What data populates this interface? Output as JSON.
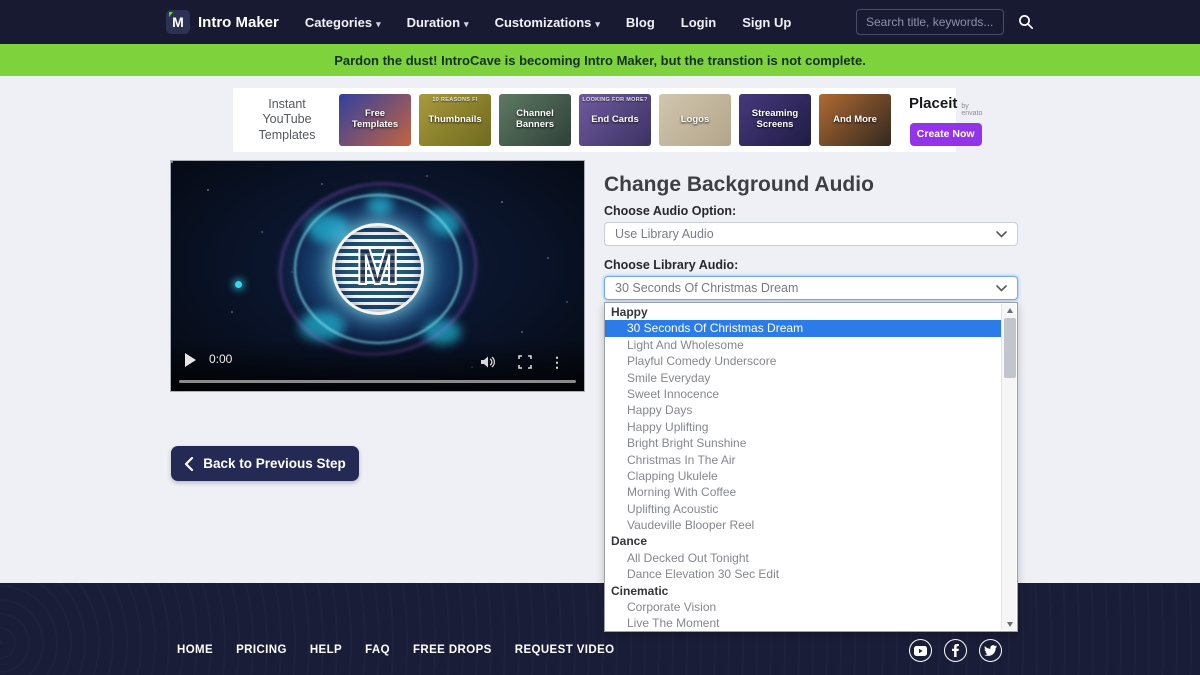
{
  "colors": {
    "navy": "#171a31",
    "footer_navy": "#1a1d37",
    "banner_green": "#7ed33d",
    "selected_blue": "#2b7ce9",
    "create_purple": "#9333ea",
    "focus_blue": "#6fb0f5"
  },
  "navbar": {
    "brand": "Intro Maker",
    "items": [
      {
        "label": "Categories",
        "caret": true
      },
      {
        "label": "Duration",
        "caret": true
      },
      {
        "label": "Customizations",
        "caret": true
      },
      {
        "label": "Blog",
        "caret": false
      },
      {
        "label": "Login",
        "caret": false
      },
      {
        "label": "Sign Up",
        "caret": false
      }
    ],
    "search_placeholder": "Search title, keywords..."
  },
  "banner": {
    "text": "Pardon the dust! IntroCave is becoming Intro Maker, but the transtion is not complete."
  },
  "template_strip": {
    "caption": "Instant YouTube Templates",
    "tiles": [
      {
        "label": "Free Templates",
        "top": "",
        "c1": "#31409f",
        "c2": "#c4643f"
      },
      {
        "label": "Thumbnails",
        "top": "10 REASONS FI",
        "c1": "#a89a3c",
        "c2": "#6f6a1f"
      },
      {
        "label": "Channel Banners",
        "top": "",
        "c1": "#5d7a63",
        "c2": "#2f4038"
      },
      {
        "label": "End Cards",
        "top": "LOOKING FOR MORE?",
        "c1": "#6e5b9e",
        "c2": "#3c3263"
      },
      {
        "label": "Logos",
        "top": "",
        "c1": "#d2c6ae",
        "c2": "#b2a58b"
      },
      {
        "label": "Streaming Screens",
        "top": "",
        "c1": "#46397c",
        "c2": "#201c45"
      },
      {
        "label": "And More",
        "top": "",
        "c1": "#b06a33",
        "c2": "#32281f"
      }
    ],
    "placeit": {
      "brand": "Placeit",
      "by": "by envato",
      "button": "Create Now"
    }
  },
  "player": {
    "time": "0:00"
  },
  "panel": {
    "title": "Change Background Audio",
    "audio_option_label": "Choose Audio Option:",
    "audio_option_value": "Use Library Audio",
    "library_label": "Choose Library Audio:",
    "library_value": "30 Seconds Of Christmas Dream"
  },
  "audio_list": {
    "selected": "30 Seconds Of Christmas Dream",
    "groups": [
      {
        "name": "Happy",
        "items": [
          "30 Seconds Of Christmas Dream",
          "Light And Wholesome",
          "Playful Comedy Underscore",
          "Smile Everyday",
          "Sweet Innocence",
          "Happy Days",
          "Happy Uplifting",
          "Bright Bright Sunshine",
          "Christmas In The Air",
          "Clapping Ukulele",
          "Morning With Coffee",
          "Uplifting Acoustic",
          "Vaudeville Blooper Reel"
        ]
      },
      {
        "name": "Dance",
        "items": [
          "All Decked Out Tonight",
          "Dance Elevation 30 Sec Edit"
        ]
      },
      {
        "name": "Cinematic",
        "items": [
          "Corporate Vision",
          "Live The Moment"
        ]
      }
    ]
  },
  "back_button": {
    "label": "Back to Previous Step"
  },
  "footer": {
    "links": [
      "HOME",
      "PRICING",
      "HELP",
      "FAQ",
      "FREE DROPS",
      "REQUEST VIDEO"
    ],
    "social": [
      "youtube",
      "facebook",
      "twitter"
    ]
  }
}
